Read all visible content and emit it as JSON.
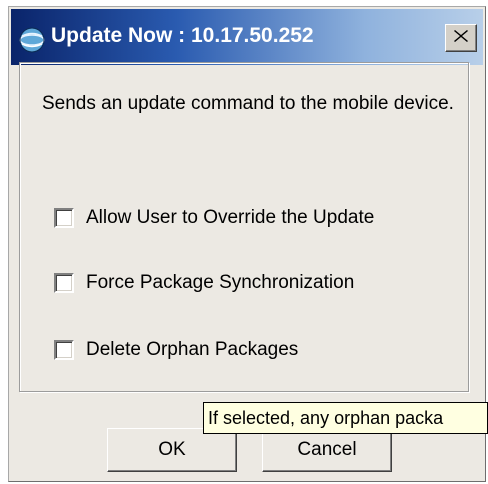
{
  "window": {
    "title": "Update Now : 10.17.50.252",
    "icon": "globe-app-icon",
    "close_icon": "close-icon"
  },
  "main": {
    "description": "Sends an update command to the mobile device.",
    "options": [
      {
        "label": "Allow User to Override the Update",
        "checked": false
      },
      {
        "label": "Force Package Synchronization",
        "checked": false
      },
      {
        "label": "Delete Orphan Packages",
        "checked": false
      }
    ]
  },
  "tooltip": {
    "text": "If selected, any orphan packa"
  },
  "buttons": {
    "ok_label": "OK",
    "cancel_label": "Cancel"
  },
  "colors": {
    "title_gradient_start": "#0a246a",
    "title_gradient_end": "#b8cfe9",
    "dialog_bg": "#ece9e3",
    "tooltip_bg": "#ffffe1"
  }
}
